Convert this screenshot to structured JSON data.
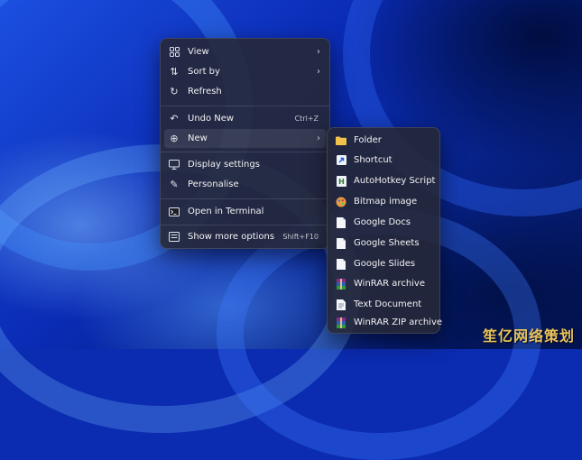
{
  "context_menu": {
    "items": [
      {
        "label": "View",
        "icon": "grid-icon"
      },
      {
        "label": "Sort by",
        "icon": "sort-icon"
      },
      {
        "label": "Refresh",
        "icon": "refresh-icon"
      },
      {
        "label": "Undo New",
        "shortcut": "Ctrl+Z",
        "icon": "undo-icon"
      },
      {
        "label": "New",
        "icon": "plus-circle-icon"
      },
      {
        "label": "Display settings",
        "icon": "display-icon"
      },
      {
        "label": "Personalise",
        "icon": "brush-icon"
      },
      {
        "label": "Open in Terminal",
        "icon": "terminal-icon"
      },
      {
        "label": "Show more options",
        "shortcut": "Shift+F10",
        "icon": "more-options-icon"
      }
    ]
  },
  "new_submenu": {
    "items": [
      {
        "label": "Folder",
        "icon": "folder-icon"
      },
      {
        "label": "Shortcut",
        "icon": "shortcut-icon"
      },
      {
        "label": "AutoHotkey Script",
        "icon": "ahk-icon"
      },
      {
        "label": "Bitmap image",
        "icon": "paint-icon"
      },
      {
        "label": "Google Docs",
        "icon": "document-icon"
      },
      {
        "label": "Google Sheets",
        "icon": "document-icon"
      },
      {
        "label": "Google Slides",
        "icon": "document-icon"
      },
      {
        "label": "WinRAR archive",
        "icon": "winrar-icon"
      },
      {
        "label": "Text Document",
        "icon": "text-document-icon"
      },
      {
        "label": "WinRAR ZIP archive",
        "icon": "winrar-zip-icon"
      }
    ]
  },
  "watermark": "笙亿网络策划",
  "colors": {
    "menu_bg": "#26283780",
    "wallpaper_blue": "#0a2bb5",
    "folder_yellow": "#f2c24b"
  }
}
